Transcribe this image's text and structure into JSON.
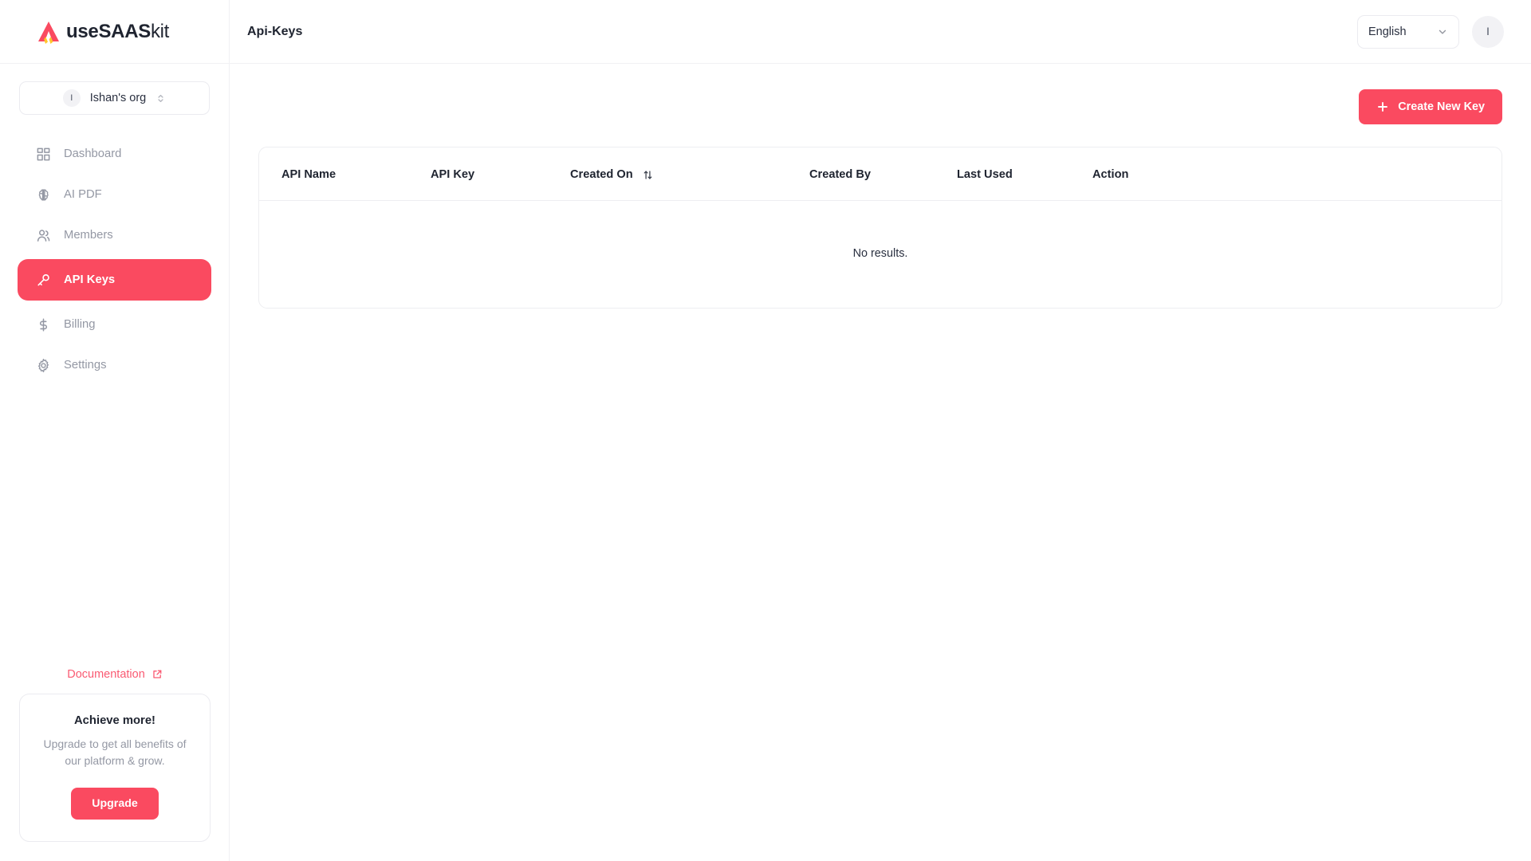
{
  "brand": {
    "logo_icon": "usesaaskit-arrow-logo",
    "name_bold": "useSAAS",
    "name_light": "kit",
    "accent_color": "#FA4A60",
    "logo_accent_secondary": "#FFC62B"
  },
  "sidebar": {
    "org_switcher": {
      "avatar_initial": "I",
      "name": "Ishan's org",
      "chevron_icon": "chevrons-up-down-icon"
    },
    "items": [
      {
        "label": "Dashboard",
        "icon": "layout-grid-icon",
        "active": false
      },
      {
        "label": "AI PDF",
        "icon": "brain-icon",
        "active": false
      },
      {
        "label": "Members",
        "icon": "users-icon",
        "active": false
      },
      {
        "label": "API Keys",
        "icon": "key-icon",
        "active": true
      },
      {
        "label": "Billing",
        "icon": "dollar-sign-icon",
        "active": false
      },
      {
        "label": "Settings",
        "icon": "gear-icon",
        "active": false
      }
    ],
    "documentation": {
      "label": "Documentation",
      "icon": "external-link-icon",
      "color": "#FA5A72"
    },
    "promo": {
      "title": "Achieve more!",
      "subtitle": "Upgrade to get all benefits of our platform & grow.",
      "button_label": "Upgrade"
    }
  },
  "topbar": {
    "title": "Api-Keys",
    "language": {
      "selected": "English",
      "chevron_icon": "chevron-down-icon",
      "options": [
        "English"
      ]
    },
    "user_avatar_initial": "I"
  },
  "main": {
    "create_button": {
      "label": "Create New Key",
      "icon": "plus-icon"
    },
    "table": {
      "columns": [
        {
          "label": "API Name",
          "sortable": false
        },
        {
          "label": "API Key",
          "sortable": false
        },
        {
          "label": "Created On",
          "sortable": true,
          "sort_icon": "arrow-up-down-icon"
        },
        {
          "label": "Created By",
          "sortable": false
        },
        {
          "label": "Last Used",
          "sortable": false
        },
        {
          "label": "Action",
          "sortable": false
        }
      ],
      "rows": [],
      "empty_message": "No results."
    }
  }
}
